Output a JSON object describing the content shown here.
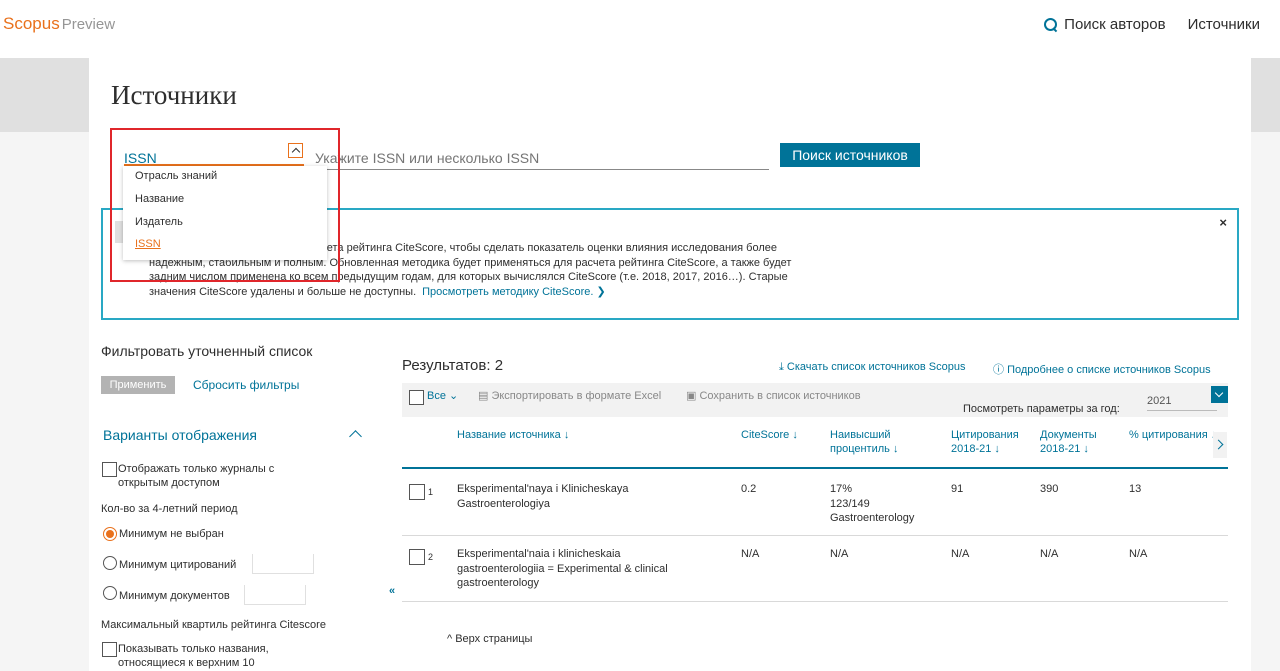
{
  "header": {
    "logo": "Scopus",
    "logo_suffix": "Preview",
    "nav": {
      "author_search": "Поиск авторов",
      "sources": "Источники"
    }
  },
  "page": {
    "title": "Источники"
  },
  "search": {
    "field_selected": "ISSN",
    "input_placeholder": "Укажите ISSN или несколько ISSN",
    "button": "Поиск источников",
    "dropdown_options": [
      "Отрасль знаний",
      "Название",
      "Издатель",
      "ISSN"
    ],
    "dropdown_selected_index": 3
  },
  "info": {
    "close": "×",
    "line1": "чета рейтинга CiteScore, чтобы сделать показатель оценки влияния исследования более",
    "line2": "надежным, стабильным и полным. Обновленная методика будет применяться для расчета рейтинга CiteScore, а также будет",
    "line3": "задним числом применена ко всем предыдущим годам, для которых вычислялся CiteScore (т.е. 2018, 2017, 2016…). Старые",
    "line4": "значения CiteScore удалены и больше не доступны.",
    "link": "Просмотреть методику CiteScore. ❯"
  },
  "filters": {
    "title": "Фильтровать уточненный список",
    "apply": "Применить",
    "reset": "Сбросить фильтры",
    "display_title": "Варианты отображения",
    "open_access_1": "Отображать только журналы с",
    "open_access_2": "открытым доступом",
    "period_label": "Кол-во за 4-летний период",
    "radio_none": "Минимум не выбран",
    "radio_citations": "Минимум цитирований",
    "radio_documents": "Минимум документов",
    "quartile_label": "Максимальный квартиль рейтинга Citescore",
    "top10_1": "Показывать только названия,",
    "top10_2": "относящиеся к верхним 10"
  },
  "results": {
    "title": "Результатов: 2",
    "download": "Скачать список источников Scopus",
    "about": "Подробнее о списке источников Scopus",
    "toolbar": {
      "all": "Все ⌄",
      "export": "Экспортировать в формате Excel",
      "save": "Сохранить в список источников",
      "view_params": "Посмотреть параметры за год:",
      "year": "2021"
    },
    "columns": {
      "name": "Название источника ↓",
      "citescore": "CiteScore ↓",
      "percentile_1": "Наивысший",
      "percentile_2": "процентиль ↓",
      "citations_1": "Цитирования",
      "citations_2": "2018-21 ↓",
      "documents_1": "Документы",
      "documents_2": "2018-21 ↓",
      "cited_pct": "% цитирования ↓"
    },
    "rows": [
      {
        "num": "1",
        "name_1": "Eksperimental'naya i Klinicheskaya",
        "name_2": "Gastroenterologiya",
        "name_3": "",
        "citescore": "0.2",
        "percentile_1": "17%",
        "percentile_2": "123/149",
        "percentile_3": "Gastroenterology",
        "citations": "91",
        "documents": "390",
        "cited_pct": "13"
      },
      {
        "num": "2",
        "name_1": "Eksperimental'naia i klinicheskaia",
        "name_2": "gastroenterologiia = Experimental & clinical",
        "name_3": "gastroenterology",
        "citescore": "N/A",
        "percentile_1": "N/A",
        "percentile_2": "",
        "percentile_3": "",
        "citations": "N/A",
        "documents": "N/A",
        "cited_pct": "N/A"
      }
    ],
    "back_to_top": "^ Верх страницы",
    "collapse_panel": "«"
  },
  "colors": {
    "accent": "#e9711c",
    "link": "#007398",
    "info_border": "#29a8c4",
    "highlight_frame": "#e0262b"
  }
}
